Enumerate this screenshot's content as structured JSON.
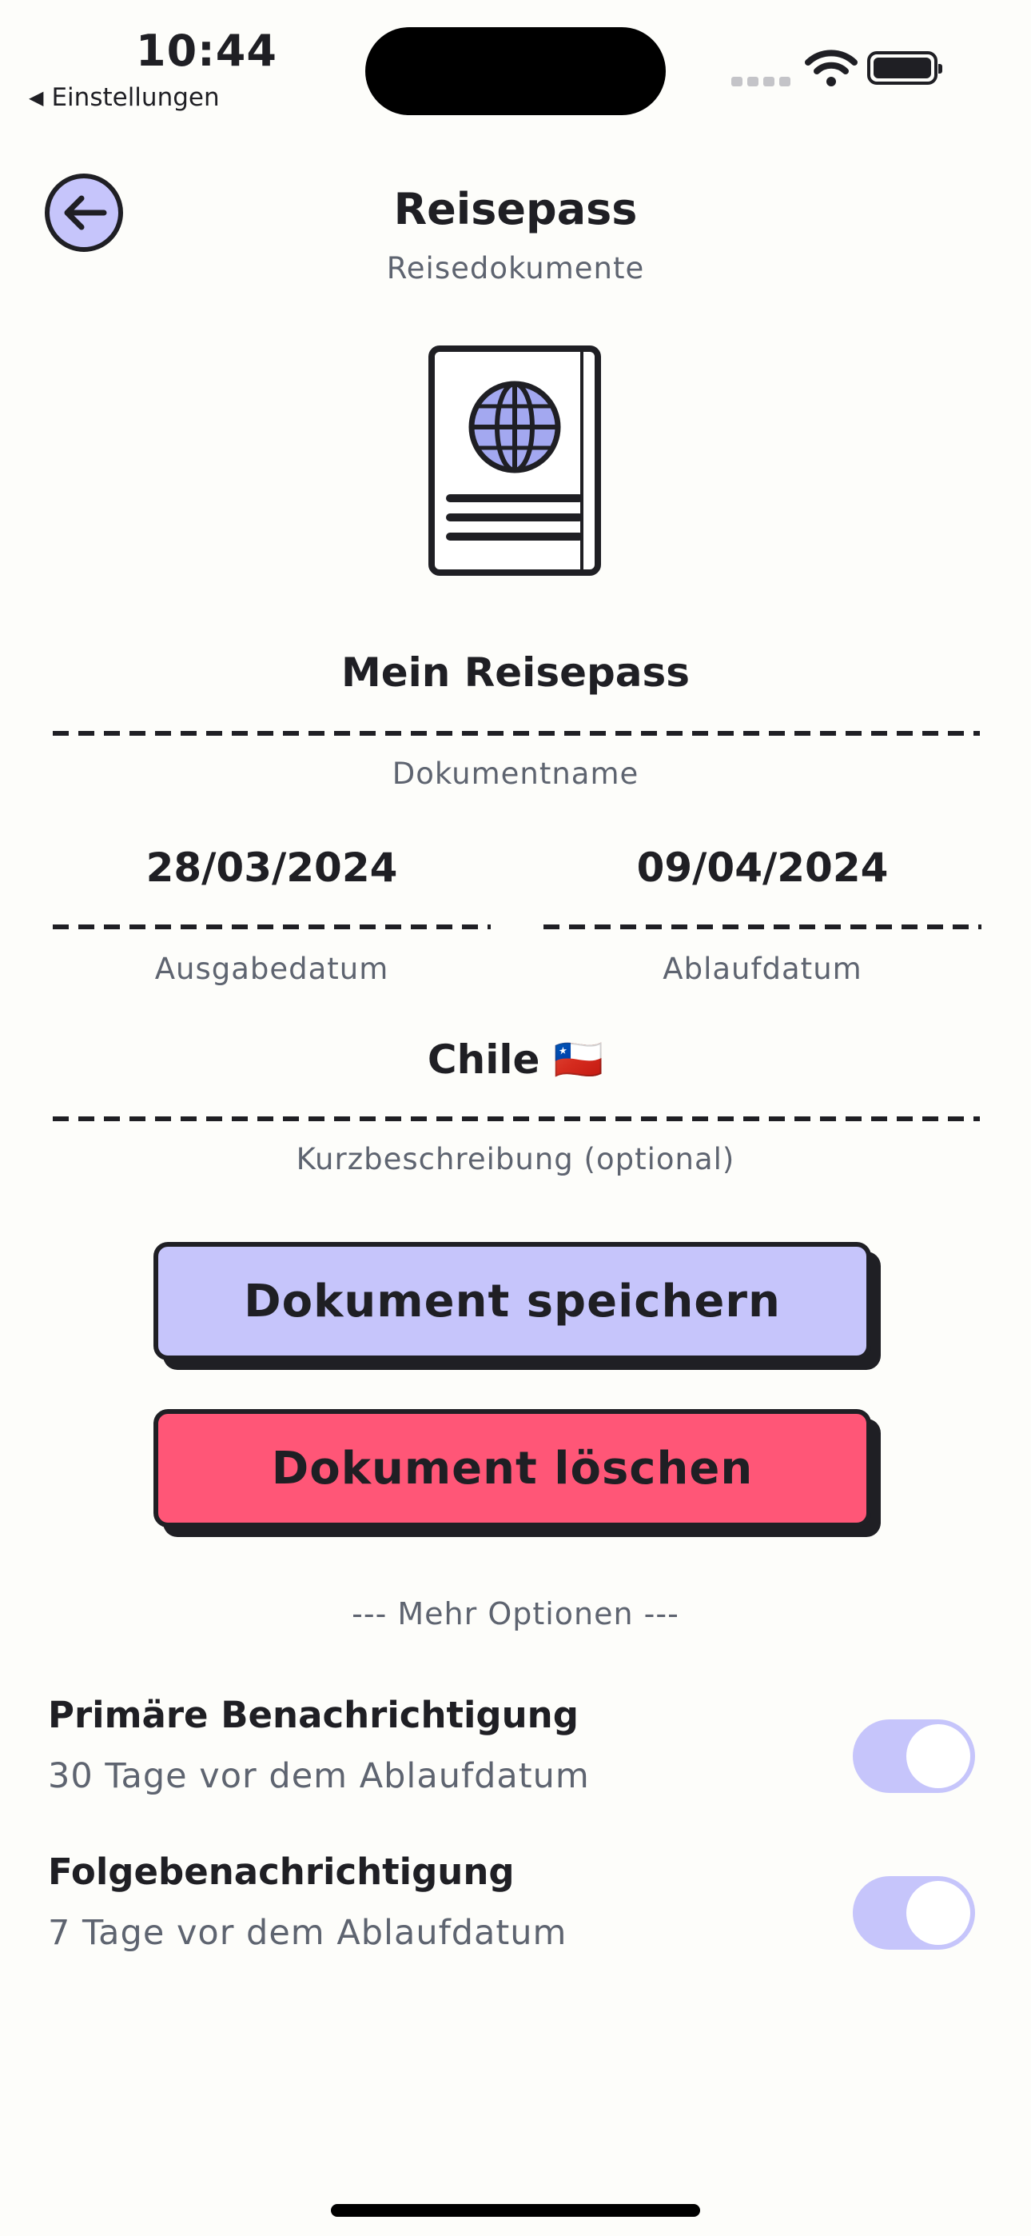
{
  "status_bar": {
    "time": "10:44",
    "back_label": "Einstellungen",
    "back_icon": "back-triangle-icon"
  },
  "header": {
    "title": "Reisepass",
    "subtitle": "Reisedokumente",
    "back_icon": "arrow-left-icon"
  },
  "illustration": {
    "icon": "passport-icon",
    "accent": "#a3a8f0"
  },
  "fields": {
    "document_name": {
      "value": "Mein Reisepass",
      "label": "Dokumentname"
    },
    "issue_date": {
      "value": "28/03/2024",
      "label": "Ausgabedatum"
    },
    "expiry_date": {
      "value": "09/04/2024",
      "label": "Ablaufdatum"
    },
    "description": {
      "value": "Chile 🇨🇱",
      "label": "Kurzbeschreibung (optional)"
    }
  },
  "buttons": {
    "save_label": "Dokument speichern",
    "delete_label": "Dokument löschen"
  },
  "more_options": "--- Mehr Optionen ---",
  "notifications": [
    {
      "title": "Primäre Benachrichtigung",
      "subtitle": "30 Tage vor dem Ablaufdatum",
      "enabled": true
    },
    {
      "title": "Folgebenachrichtigung",
      "subtitle": "7 Tage vor dem Ablaufdatum",
      "enabled": true
    }
  ],
  "colors": {
    "background": "#fdfdfa",
    "primary": "#c6c5fb",
    "danger": "#ff5677",
    "ink": "#1f1f24",
    "muted": "#5e6470"
  }
}
